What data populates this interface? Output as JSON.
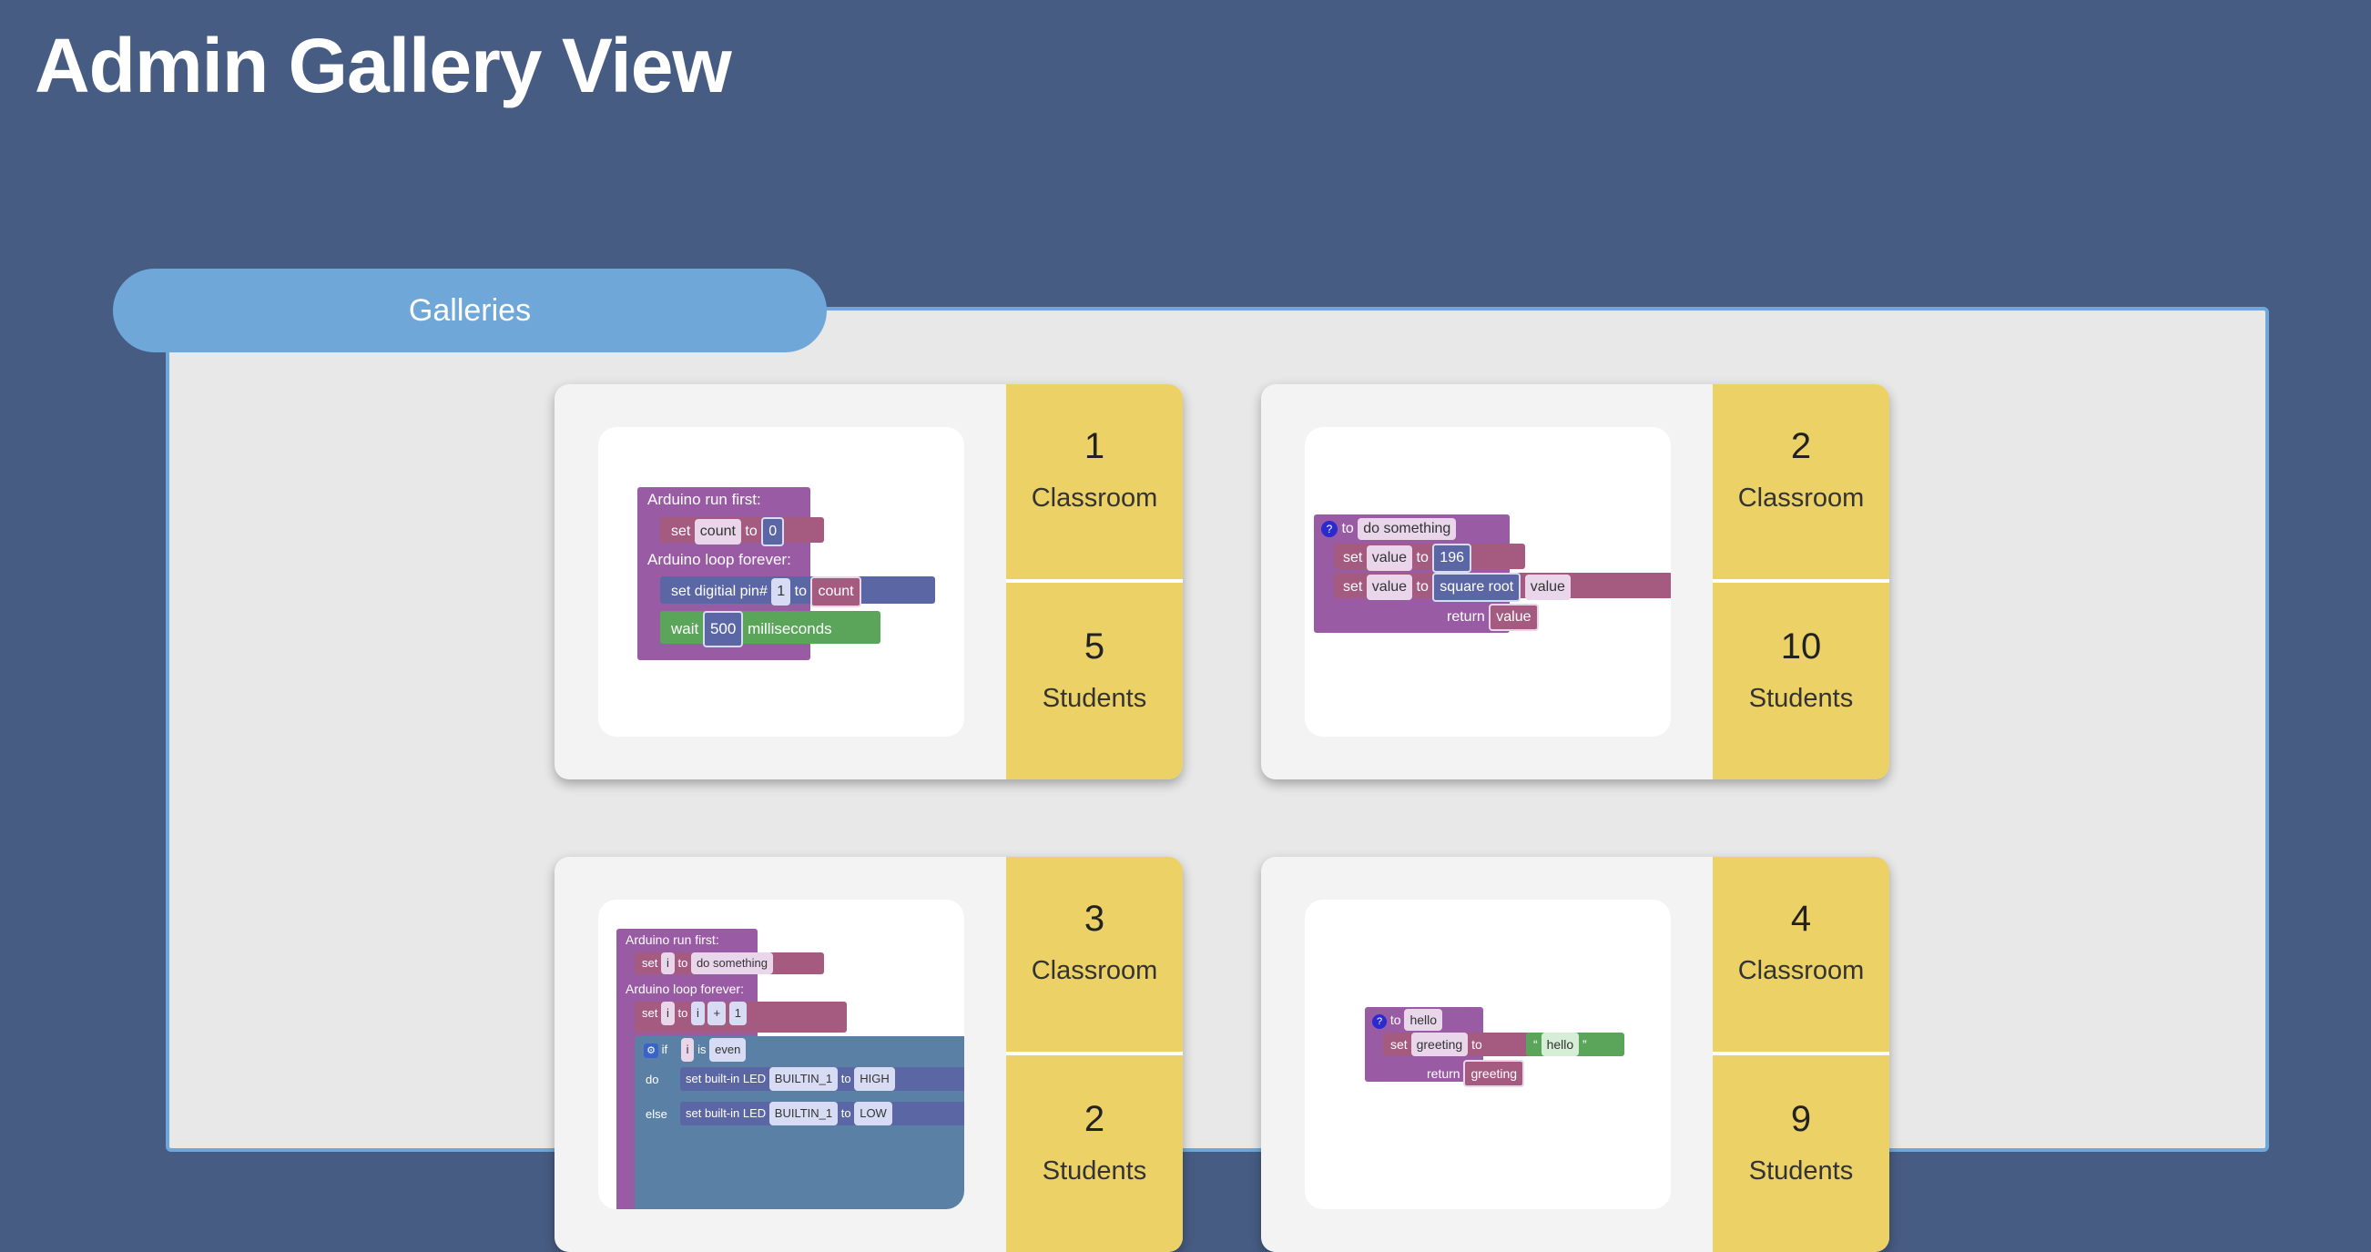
{
  "page_title": "Admin Gallery View",
  "tab_label": "Galleries",
  "cards": [
    {
      "classroom_number": "1",
      "classroom_label": "Classroom",
      "students_number": "5",
      "students_label": "Students"
    },
    {
      "classroom_number": "2",
      "classroom_label": "Classroom",
      "students_number": "10",
      "students_label": "Students"
    },
    {
      "classroom_number": "3",
      "classroom_label": "Classroom",
      "students_number": "2",
      "students_label": "Students"
    },
    {
      "classroom_number": "4",
      "classroom_label": "Classroom",
      "students_number": "9",
      "students_label": "Students"
    }
  ],
  "thumbs": {
    "t1": {
      "run_first": "Arduino run first:",
      "set": "set",
      "var": "count",
      "to": "to",
      "zero": "0",
      "loop": "Arduino loop forever:",
      "set_pin": "set digitial pin#",
      "pin": "1",
      "to2": "to",
      "var2": "count",
      "wait": "wait",
      "ms_value": "500",
      "ms": "milliseconds"
    },
    "t2": {
      "to_do": "to",
      "fn_name": "do something",
      "set1": "set",
      "var1": "value",
      "to1": "to",
      "num": "196",
      "set2": "set",
      "var2": "value",
      "to2": "to",
      "op": "square root",
      "var3": "value",
      "return": "return",
      "ret_var": "value"
    },
    "t3": {
      "run_first": "Arduino run first:",
      "set1": "set",
      "var1": "i",
      "to1": "to",
      "str1": "do something",
      "loop": "Arduino loop forever:",
      "set2": "set",
      "var2": "i",
      "to2": "to",
      "var3": "i",
      "op": "+",
      "one": "1",
      "if": "if",
      "var4": "i",
      "is": "is",
      "even": "even",
      "do": "do",
      "led1": "set built-in LED",
      "builtin1": "BUILTIN_1",
      "to3": "to",
      "high": "HIGH",
      "else": "else",
      "led2": "set built-in LED",
      "builtin2": "BUILTIN_1",
      "to4": "to",
      "low": "LOW"
    },
    "t4": {
      "to_fn": "to",
      "fn_name": "hello",
      "set": "set",
      "var": "greeting",
      "to": "to",
      "str": "hello",
      "return": "return",
      "ret_var": "greeting"
    }
  }
}
